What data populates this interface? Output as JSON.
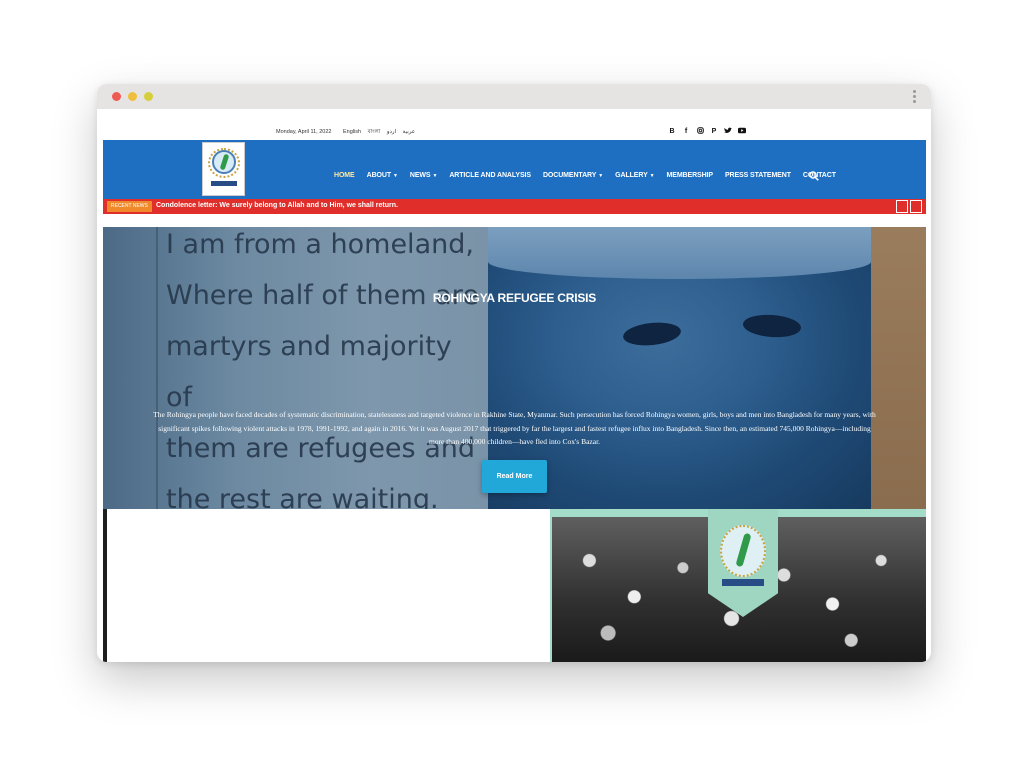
{
  "topbar": {
    "date": "Monday, April 11, 2022",
    "languages": [
      "English",
      "বাংলা",
      "عربية",
      "اردو"
    ],
    "socials": [
      "blogger-icon",
      "facebook-icon",
      "instagram-icon",
      "pinterest-icon",
      "twitter-icon",
      "youtube-icon"
    ]
  },
  "nav": {
    "items": [
      {
        "label": "HOME",
        "active": true
      },
      {
        "label": "ABOUT",
        "dropdown": true
      },
      {
        "label": "NEWS",
        "dropdown": true
      },
      {
        "label": "ARTICLE AND ANALYSIS"
      },
      {
        "label": "DOCUMENTARY",
        "dropdown": true
      },
      {
        "label": "GALLERY",
        "dropdown": true
      },
      {
        "label": "MEMBERSHIP"
      },
      {
        "label": "PRESS STATEMENT"
      },
      {
        "label": "CONTACT"
      }
    ],
    "search_icon": "search-icon",
    "color": "#1e6fc2"
  },
  "ticker": {
    "badge": "RECENT NEWS",
    "headline": "Condolence letter: We surely belong to Allah and to Him, we shall return.",
    "color": "#e02f2b"
  },
  "hero": {
    "poem_lines": [
      "I am from a homeland,",
      "Where half of them are",
      "martyrs and majority of",
      "them are refugees and",
      "the rest are waiting."
    ],
    "title": "ROHINGYA REFUGEE CRISIS",
    "description": "The Rohingya people have faced decades of systematic discrimination, statelessness and targeted violence in Rakhine State, Myanmar. Such persecution has forced Rohingya women, girls, boys and men into Bangladesh for many years, with significant spikes following violent attacks in 1978, 1991-1992, and again in 2016. Yet it was August 2017 that triggered by far the largest and fastest refugee influx into Bangladesh. Since then, an estimated 745,000 Rohingya—including more than 400,000 children—have fled into Cox's Bazar.",
    "button": "Read More",
    "button_color": "#21a7d8"
  }
}
